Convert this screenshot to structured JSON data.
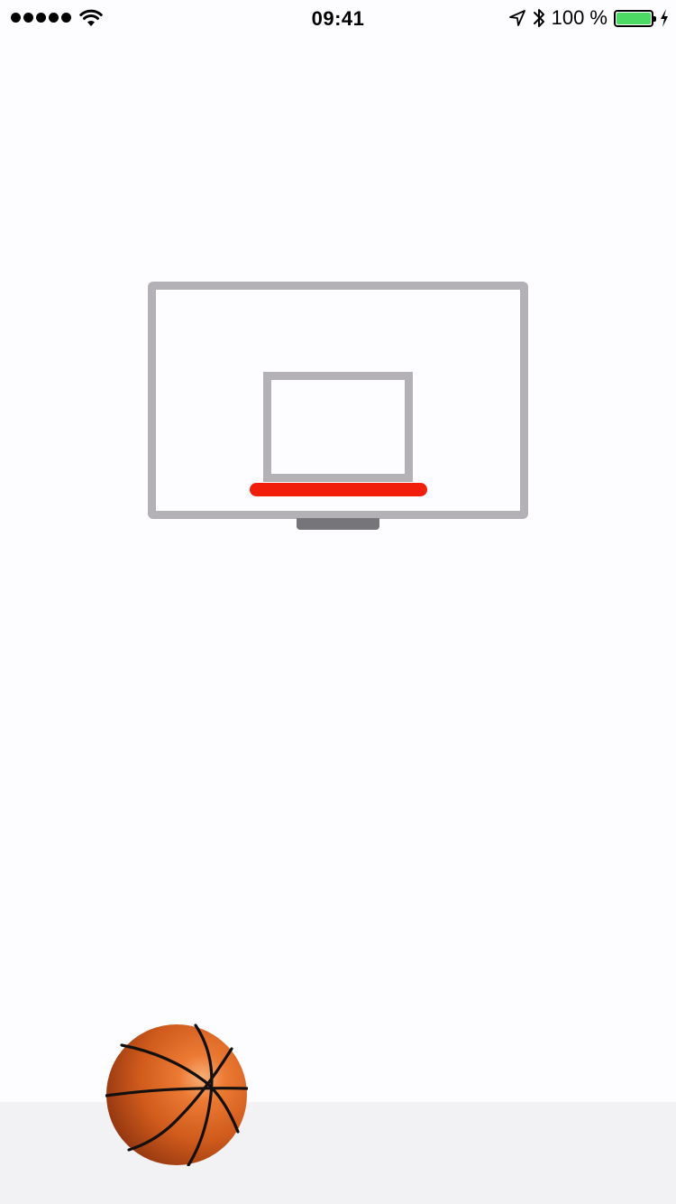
{
  "status_bar": {
    "time": "09:41",
    "battery_percent_label": "100 %",
    "battery_level": 1.0,
    "signal_bars": 5,
    "icons": [
      "signal-dots",
      "wifi-icon",
      "location-arrow-icon",
      "bluetooth-icon",
      "battery-icon",
      "charging-bolt-icon"
    ]
  },
  "game": {
    "colors": {
      "backboard": "#b3b1b6",
      "rim": "#f11e0b",
      "bracket": "#76757a",
      "ball": "#d9601f",
      "floor": "#f2f2f4"
    }
  }
}
